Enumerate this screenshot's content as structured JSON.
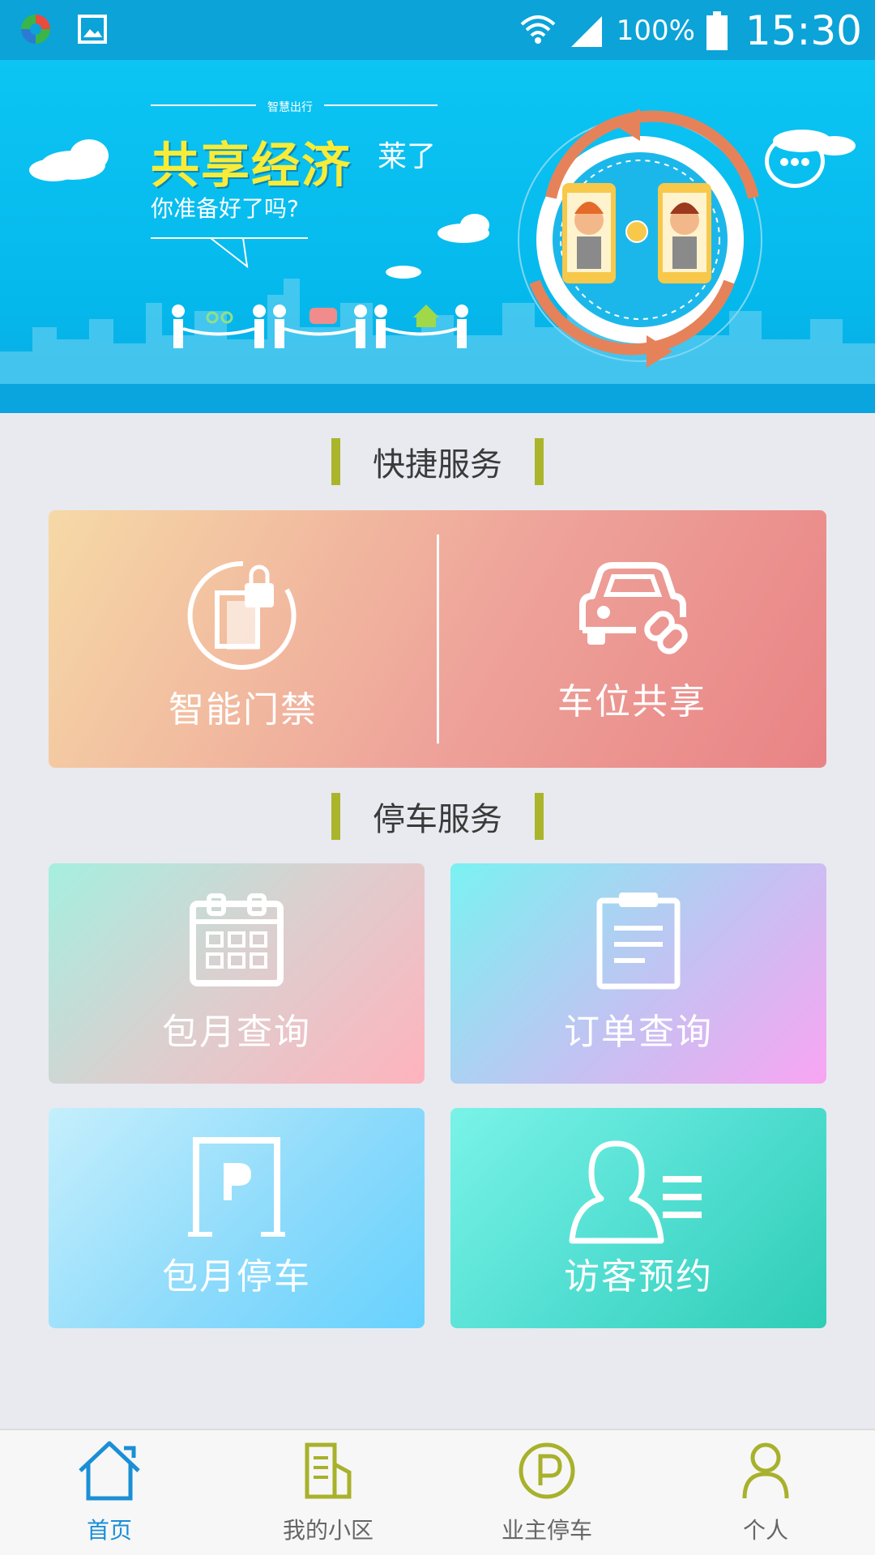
{
  "status_bar": {
    "battery_percent": "100%",
    "time": "15:30",
    "icons": [
      "app-notification-icon",
      "image-notification-icon",
      "wifi-icon",
      "signal-icon",
      "battery-icon"
    ]
  },
  "banner": {
    "small_caption": "智慧出行",
    "title": "共享经济",
    "title_suffix": "莱了",
    "subtitle": "你准备好了吗?"
  },
  "sections": {
    "quick_services": {
      "title": "快捷服务",
      "items": [
        {
          "label": "智能门禁",
          "icon": "door-lock-icon"
        },
        {
          "label": "车位共享",
          "icon": "car-share-icon"
        }
      ]
    },
    "parking_services": {
      "title": "停车服务",
      "items": [
        {
          "label": "包月查询",
          "icon": "calendar-icon"
        },
        {
          "label": "订单查询",
          "icon": "clipboard-icon"
        },
        {
          "label": "包月停车",
          "icon": "parking-gate-icon"
        },
        {
          "label": "访客预约",
          "icon": "visitor-icon"
        }
      ]
    }
  },
  "bottom_nav": {
    "items": [
      {
        "label": "首页",
        "icon": "home-icon",
        "active": true
      },
      {
        "label": "我的小区",
        "icon": "community-icon",
        "active": false
      },
      {
        "label": "业主停车",
        "icon": "parking-icon",
        "active": false
      },
      {
        "label": "个人",
        "icon": "person-icon",
        "active": false
      }
    ]
  },
  "colors": {
    "status_bar": "#0ba3d8",
    "banner": "#05b8ec",
    "section_bar": "#aab52c",
    "nav_active": "#1b8fd6",
    "nav_inactive_icon": "#a8b12b"
  }
}
